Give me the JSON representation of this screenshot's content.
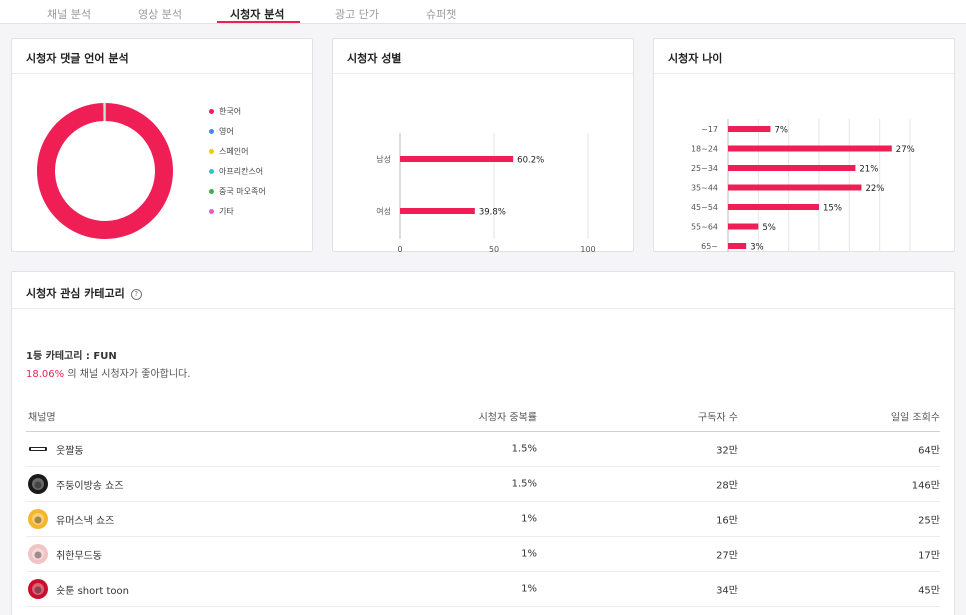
{
  "tabs": [
    "채널 분석",
    "영상 분석",
    "시청자 분석",
    "광고 단가",
    "슈퍼챗"
  ],
  "active_tab": 2,
  "colors": {
    "accent": "#ef1f55"
  },
  "language_card": {
    "title": "시청자 댓글 언어 분석",
    "legend": [
      {
        "label": "한국어",
        "color": "#ef1f55"
      },
      {
        "label": "영어",
        "color": "#4a86e8"
      },
      {
        "label": "스페인어",
        "color": "#f2c811"
      },
      {
        "label": "아프리칸스어",
        "color": "#2ec4c4"
      },
      {
        "label": "중국 마오족어",
        "color": "#3cb043"
      },
      {
        "label": "기타",
        "color": "#e05cc8"
      }
    ]
  },
  "gender_card": {
    "title": "시청자 성별"
  },
  "age_card": {
    "title": "시청자 나이"
  },
  "interest_card": {
    "title": "시청자 관심 카테고리",
    "help_icon": "question-circle-icon",
    "top_category": "1등 카테고리 : FUN",
    "top_pct": "18.06%",
    "top_desc": " 의 채널 시청자가 좋아합니다."
  },
  "table": {
    "headers": [
      "채널명",
      "시청자 중복률",
      "구독자 수",
      "일일 조회수"
    ],
    "rows": [
      {
        "name": "웃짤동",
        "overlap": "1.5%",
        "subs": "32만",
        "daily": "64만",
        "avatar_color": "#ffffff",
        "avatar_icon": "oxxc-logo-icon"
      },
      {
        "name": "주둥이방송 쇼즈",
        "overlap": "1.5%",
        "subs": "28만",
        "daily": "146만",
        "avatar_color": "#1a1a1a",
        "avatar_icon": "channel-avatar-icon"
      },
      {
        "name": "유머스낵 쇼즈",
        "overlap": "1%",
        "subs": "16만",
        "daily": "25만",
        "avatar_color": "#f5b62a",
        "avatar_icon": "channel-avatar-icon"
      },
      {
        "name": "취한무드동",
        "overlap": "1%",
        "subs": "27만",
        "daily": "17만",
        "avatar_color": "#f0c4c4",
        "avatar_icon": "channel-avatar-icon"
      },
      {
        "name": "숏툰 short toon",
        "overlap": "1%",
        "subs": "34만",
        "daily": "45만",
        "avatar_color": "#c8102e",
        "avatar_icon": "channel-avatar-icon"
      }
    ]
  },
  "chart_data": [
    {
      "type": "pie",
      "categories": [
        "한국어",
        "영어",
        "스페인어",
        "아프리칸스어",
        "중국 마오족어",
        "기타"
      ],
      "values": [
        99.5,
        0.1,
        0.1,
        0.1,
        0.1,
        0.1
      ],
      "title": "시청자 댓글 언어 분석"
    },
    {
      "type": "bar",
      "orientation": "horizontal",
      "categories": [
        "남성",
        "여성"
      ],
      "values": [
        60.2,
        39.8
      ],
      "data_labels": [
        "60.2%",
        "39.8%"
      ],
      "xticks": [
        "0",
        "50",
        "100"
      ],
      "xlim": [
        0,
        100
      ],
      "title": "시청자 성별"
    },
    {
      "type": "bar",
      "orientation": "horizontal",
      "categories": [
        "~17",
        "18~24",
        "25~34",
        "35~44",
        "45~54",
        "55~64",
        "65~"
      ],
      "values": [
        7,
        27,
        21,
        22,
        15,
        5,
        3
      ],
      "data_labels": [
        "7%",
        "27%",
        "21%",
        "22%",
        "15%",
        "5%",
        "3%"
      ],
      "xticks": [
        "0",
        "5",
        "10",
        "15",
        "20",
        "25",
        "30"
      ],
      "xlim": [
        0,
        30
      ],
      "title": "시청자 나이"
    }
  ]
}
